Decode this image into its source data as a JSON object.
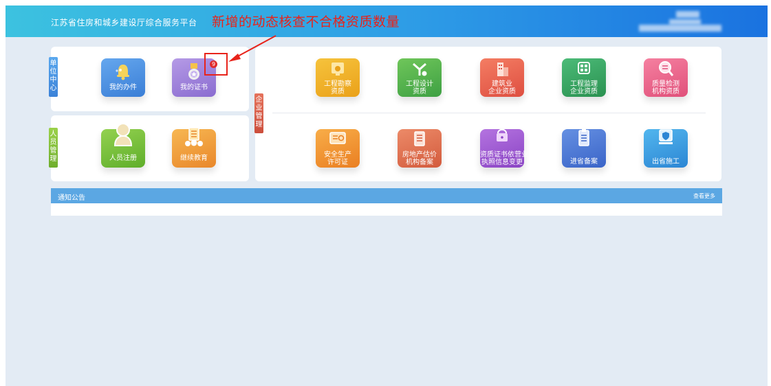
{
  "header": {
    "site_title": "江苏省住房和城乡建设厅综合服务平台",
    "annotation": "新增的动态核查不合格资质数量"
  },
  "unit_center": {
    "tab_label": "单位中心",
    "items": [
      {
        "label": "我的办件",
        "icon": "bell-icon",
        "color": "#4a90dc"
      },
      {
        "label": "我的证书",
        "icon": "medal-icon",
        "color": "#9a7fd6",
        "badge": "9"
      }
    ]
  },
  "person_management": {
    "tab_label": "人员管理",
    "items": [
      {
        "label": "人员注册",
        "icon": "person-icon",
        "color": "#7cc33e"
      },
      {
        "label": "继续教育",
        "icon": "education-icon",
        "color": "#f0a23a"
      }
    ]
  },
  "enterprise_management": {
    "tab_label": "企业管理",
    "row1": [
      {
        "label_lines": [
          "工程勘察",
          "资质"
        ],
        "icon": "certificate-icon",
        "color": "#f1b324"
      },
      {
        "label_lines": [
          "工程设计",
          "资质"
        ],
        "icon": "drafting-icon",
        "color": "#5fba4e"
      },
      {
        "label_lines": [
          "建筑业",
          "企业资质"
        ],
        "icon": "building-icon",
        "color": "#ef6a5a"
      },
      {
        "label_lines": [
          "工程监理",
          "企业资质"
        ],
        "icon": "monitor-icon",
        "color": "#37a866"
      },
      {
        "label_lines": [
          "质量检测",
          "机构资质"
        ],
        "icon": "magnifier-icon",
        "color": "#ee6b8c"
      }
    ],
    "row2": [
      {
        "label_lines": [
          "安全生产",
          "许可证"
        ],
        "icon": "license-icon",
        "color": "#f39a2a"
      },
      {
        "label_lines": [
          "房地产估价",
          "机构备案"
        ],
        "icon": "document-icon",
        "color": "#e16f4f"
      },
      {
        "label_lines": [
          "资质证书依营业",
          "执照信息变更"
        ],
        "icon": "folder-icon",
        "color": "#a05bd1"
      },
      {
        "label_lines": [
          "进省备案"
        ],
        "icon": "clipboard-icon",
        "color": "#4a78d6"
      },
      {
        "label_lines": [
          "出省施工"
        ],
        "icon": "shield-icon",
        "color": "#3a9ee0"
      }
    ]
  },
  "notice": {
    "title": "通知公告",
    "more": "查看更多"
  }
}
